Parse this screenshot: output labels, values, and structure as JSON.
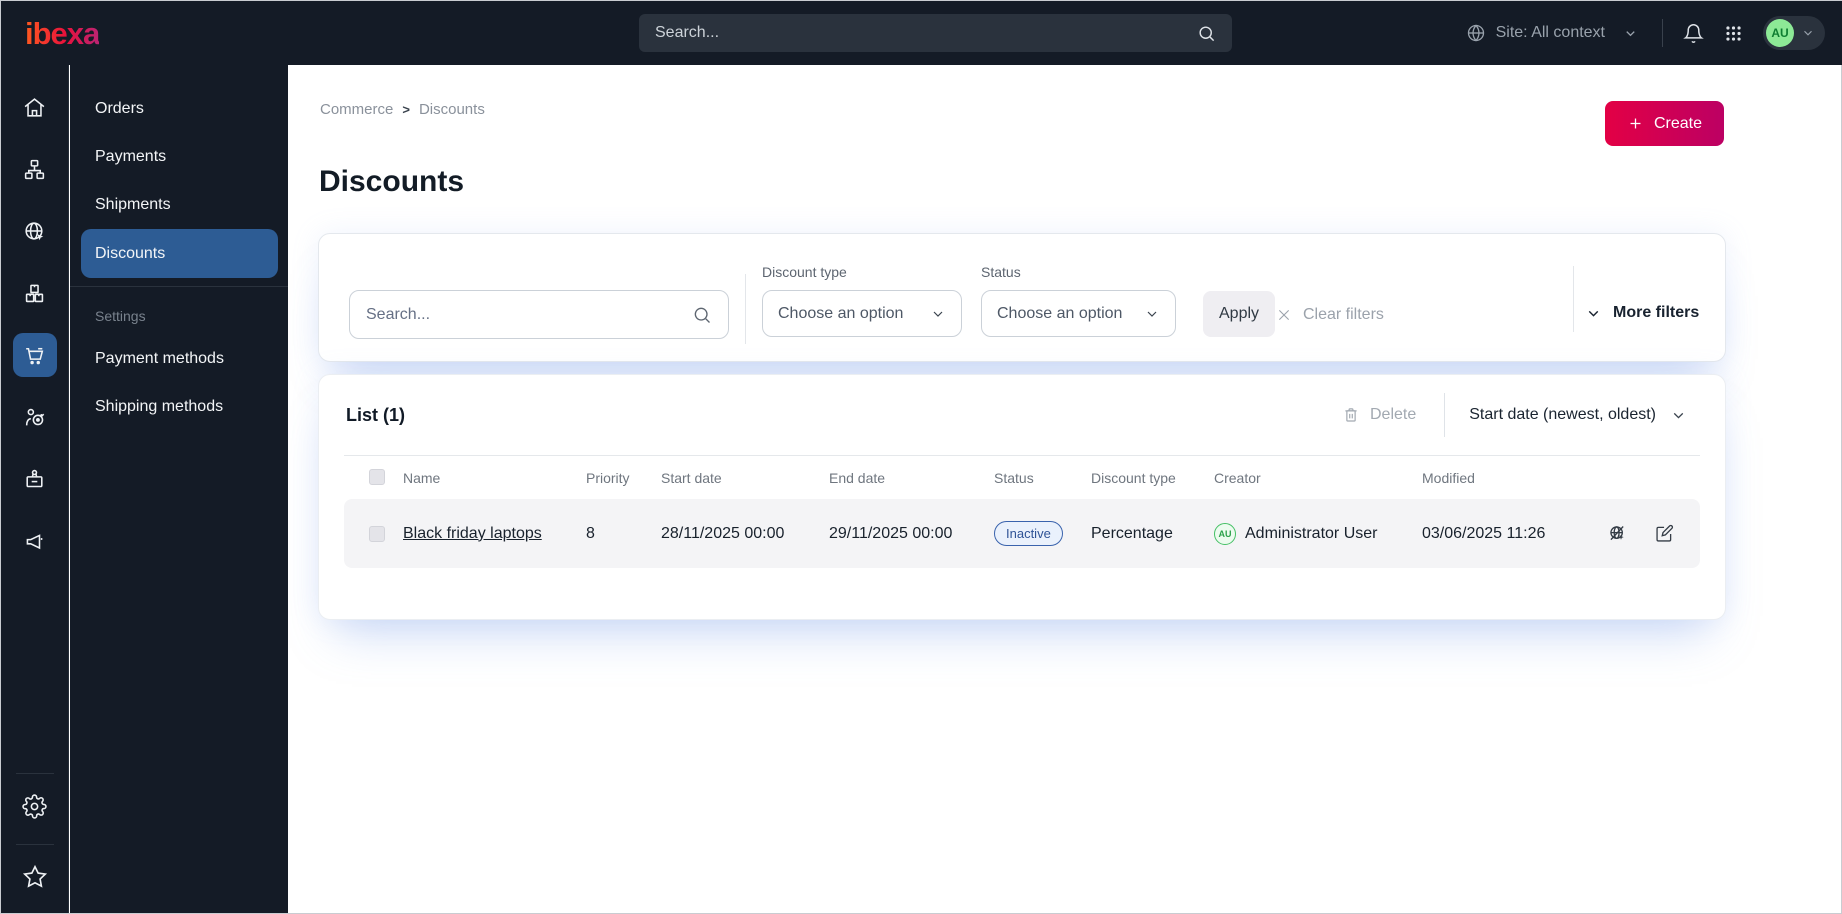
{
  "topbar": {
    "logo": "ibexa",
    "search_placeholder": "Search...",
    "site_context": "Site: All context",
    "avatar_initials": "AU",
    "icons": [
      "site-globe-icon",
      "chevron-down-icon",
      "bell-icon",
      "app-grid-icon"
    ]
  },
  "rail": {
    "icons": [
      "home-icon",
      "content-tree-icon",
      "site-globe-cursor-icon",
      "products-boxes-icon",
      "commerce-cart-icon",
      "personalization-target-icon",
      "customers-badge-icon",
      "marketing-megaphone-icon",
      "gear-icon",
      "star-icon"
    ],
    "active": "commerce-cart-icon"
  },
  "menu": {
    "items": [
      {
        "label": "Orders"
      },
      {
        "label": "Payments"
      },
      {
        "label": "Shipments"
      },
      {
        "label": "Discounts"
      }
    ],
    "active": "Discounts",
    "settings_label": "Settings",
    "settings_items": [
      {
        "label": "Payment methods"
      },
      {
        "label": "Shipping methods"
      }
    ]
  },
  "breadcrumb": {
    "items": [
      "Commerce",
      "Discounts"
    ],
    "separator": ">"
  },
  "page": {
    "title": "Discounts",
    "create_label": "Create"
  },
  "filters": {
    "search_placeholder": "Search...",
    "discount_type_label": "Discount type",
    "discount_type_value": "Choose an option",
    "status_label": "Status",
    "status_value": "Choose an option",
    "apply_label": "Apply",
    "clear_label": "Clear filters",
    "more_label": "More filters"
  },
  "list": {
    "title": "List (1)",
    "delete_label": "Delete",
    "sort_label": "Start date (newest, oldest)",
    "columns": {
      "name": "Name",
      "priority": "Priority",
      "start_date": "Start date",
      "end_date": "End date",
      "status": "Status",
      "discount_type": "Discount type",
      "creator": "Creator",
      "modified": "Modified"
    },
    "rows": [
      {
        "name": "Black friday laptops",
        "priority": "8",
        "start_date": "28/11/2025 00:00",
        "end_date": "29/11/2025 00:00",
        "status": "Inactive",
        "discount_type": "Percentage",
        "creator": "Administrator User",
        "creator_initials": "AU",
        "modified": "03/06/2025 11:26"
      }
    ]
  },
  "colors": {
    "topbar_bg": "#141b26",
    "active_blue": "#2d5c94",
    "brand_gradient_start": "#e30045",
    "brand_gradient_end": "#bc0063",
    "badge_inactive_border": "#3a63ad",
    "avatar_green": "#45c065",
    "row_bg": "#f4f4f6"
  }
}
